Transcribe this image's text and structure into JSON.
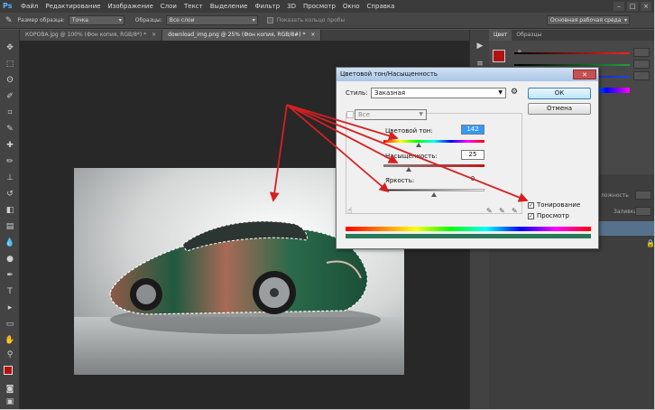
{
  "menubar": {
    "logo": "Ps",
    "items": [
      "Файл",
      "Редактирование",
      "Изображение",
      "Слои",
      "Текст",
      "Выделение",
      "Фильтр",
      "3D",
      "Просмотр",
      "Окно",
      "Справка"
    ],
    "window_controls": [
      "–",
      "□",
      "×"
    ]
  },
  "options_bar": {
    "sample_size_label": "Размер образца:",
    "sample_size_value": "Точка",
    "samples_label": "Образцы:",
    "samples_value": "Все слои",
    "show_ring_label": "Показать кольцо пробы",
    "workspace_value": "Основная рабочая среда"
  },
  "tabs": [
    {
      "label": "КОРОВА.jpg @ 100% (Фон копия, RGB/8*) *",
      "close": "×"
    },
    {
      "label": "download_img.png @ 25% (Фон копия, RGB/8#) *",
      "close": "×"
    }
  ],
  "right_panel": {
    "tabs": [
      "Цвет",
      "Образцы"
    ],
    "channel_r": "R",
    "partial_text_1": "ложность",
    "partial_text_2": "Заливка:"
  },
  "dialog": {
    "title": "Цветовой тон/Насыщенность",
    "close": "✕",
    "style_label": "Стиль:",
    "style_value": "Заказная",
    "ok_label": "ОК",
    "cancel_label": "Отмена",
    "channel_value": "Все",
    "hue_label": "Цветовой тон:",
    "hue_value": "142",
    "saturation_label": "Насыщенность:",
    "saturation_value": "25",
    "lightness_label": "Яркость:",
    "lightness_value": "0",
    "colorize_label": "Тонирование",
    "colorize_checked": true,
    "preview_label": "Просмотр",
    "preview_checked": true,
    "hue_fraction": 0.35,
    "saturation_fraction": 0.25,
    "lightness_fraction": 0.5
  },
  "colors": {
    "foreground": "#b31212",
    "background": "#ffffff",
    "arrow": "#d62020",
    "car_body": "#1f5a40"
  },
  "icons": [
    "eyedropper-icon",
    "move-icon",
    "marquee-icon",
    "lasso-icon",
    "quick-select-icon",
    "crop-icon",
    "brush-icon",
    "stamp-icon",
    "eraser-icon",
    "gradient-icon",
    "pen-icon",
    "type-icon",
    "hand-icon",
    "zoom-icon",
    "hand-drag-icon"
  ]
}
